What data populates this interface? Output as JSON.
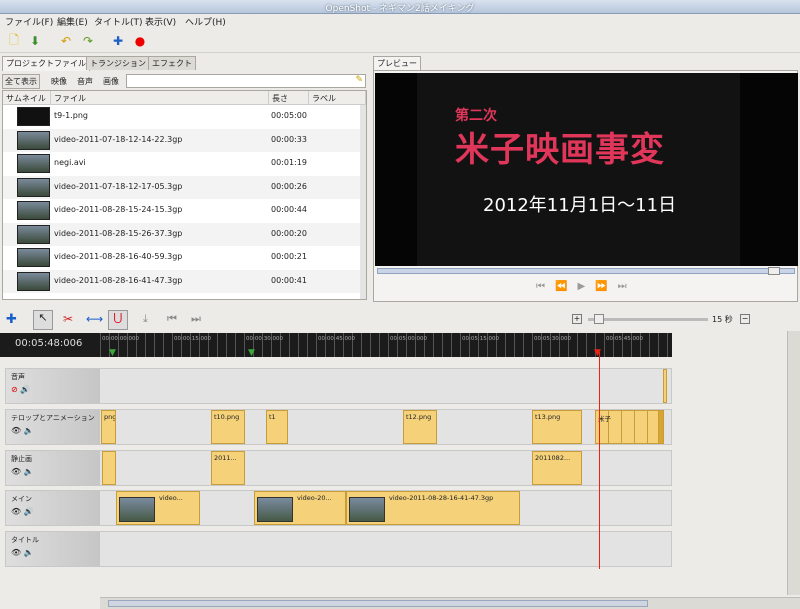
{
  "window": {
    "title": "OpenShot - ネギマン2話メイキング"
  },
  "menu": [
    "ファイル(F)",
    "編集(E)",
    "タイトル(T)",
    "表示(V)",
    "ヘルプ(H)"
  ],
  "tabs_left": [
    "プロジェクトファイル",
    "トランジション",
    "エフェクト"
  ],
  "tabs_right": [
    "プレビュー"
  ],
  "filter": {
    "all": "全て表示",
    "video": "映像",
    "audio": "音声",
    "image": "画像"
  },
  "columns": {
    "thumb": "サムネイル",
    "file": "ファイル",
    "length": "長さ",
    "label": "ラベル"
  },
  "files": [
    {
      "name": "t9-1.png",
      "length": "00:05:00"
    },
    {
      "name": "video-2011-07-18-12-14-22.3gp",
      "length": "00:00:33"
    },
    {
      "name": "negi.avi",
      "length": "00:01:19"
    },
    {
      "name": "video-2011-07-18-12-17-05.3gp",
      "length": "00:00:26"
    },
    {
      "name": "video-2011-08-28-15-24-15.3gp",
      "length": "00:00:44"
    },
    {
      "name": "video-2011-08-28-15-26-37.3gp",
      "length": "00:00:20"
    },
    {
      "name": "video-2011-08-28-16-40-59.3gp",
      "length": "00:00:21"
    },
    {
      "name": "video-2011-08-28-16-41-47.3gp",
      "length": "00:00:41"
    }
  ],
  "preview": {
    "line1": "第二次",
    "line2": "米子映画事変",
    "date": "2012年11月1日～11日"
  },
  "timeline": {
    "current_time": "00:05:48:006",
    "zoom": "15 秒",
    "ticks": [
      "00:00:00:000",
      "00:00:15:000",
      "00:00:30:000",
      "00:00:45:000",
      "00:05:00:000",
      "00:05:15:000",
      "00:05:30:000",
      "00:05:45:000"
    ],
    "tracks": [
      {
        "name": "音声"
      },
      {
        "name": "テロップとアニメーション",
        "clips": [
          "png",
          "t10.png",
          "t1",
          "t12.png",
          "t13.png",
          "米子"
        ]
      },
      {
        "name": "静止画",
        "clips": [
          "2011...",
          "2011082..."
        ]
      },
      {
        "name": "メイン",
        "clips": [
          "video...",
          "video-20...",
          "video-2011-08-28-16-41-47.3gp"
        ]
      },
      {
        "name": "タイトル"
      }
    ]
  },
  "colors": {
    "accent": "#e0365a",
    "clip": "#f5d27a",
    "playhead": "#e21"
  }
}
